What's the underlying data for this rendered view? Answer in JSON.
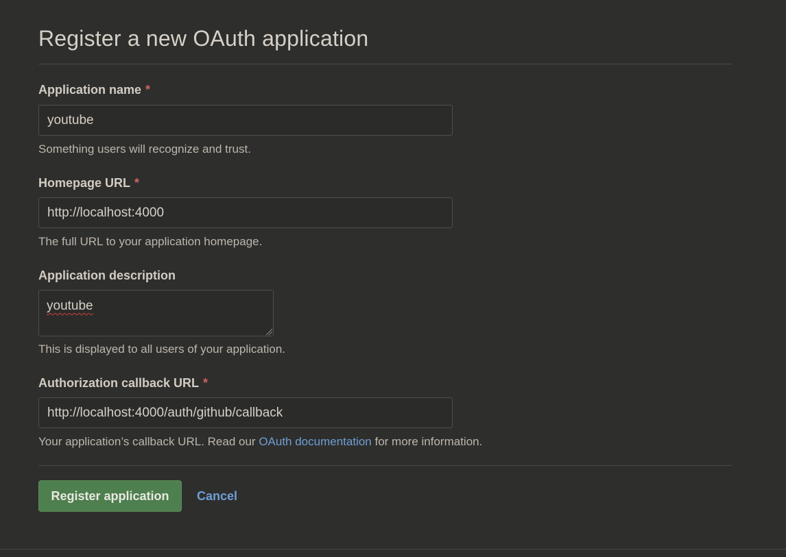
{
  "page": {
    "title": "Register a new OAuth application"
  },
  "form": {
    "app_name": {
      "label": "Application name",
      "required_mark": "*",
      "value": "youtube",
      "hint": "Something users will recognize and trust."
    },
    "homepage_url": {
      "label": "Homepage URL",
      "required_mark": "*",
      "value": "http://localhost:4000",
      "hint": "The full URL to your application homepage."
    },
    "description": {
      "label": "Application description",
      "value": "youtube",
      "hint": "This is displayed to all users of your application."
    },
    "callback_url": {
      "label": "Authorization callback URL",
      "required_mark": "*",
      "value": "http://localhost:4000/auth/github/callback",
      "hint_before": "Your application’s callback URL. Read our",
      "hint_link": "OAuth documentation",
      "hint_after": "for more information."
    }
  },
  "actions": {
    "register_label": "Register application",
    "cancel_label": "Cancel"
  },
  "colors": {
    "background": "#2e2e2d",
    "primary_button": "#4e7f4e",
    "link": "#6f9fd4",
    "required": "#c9655b"
  }
}
